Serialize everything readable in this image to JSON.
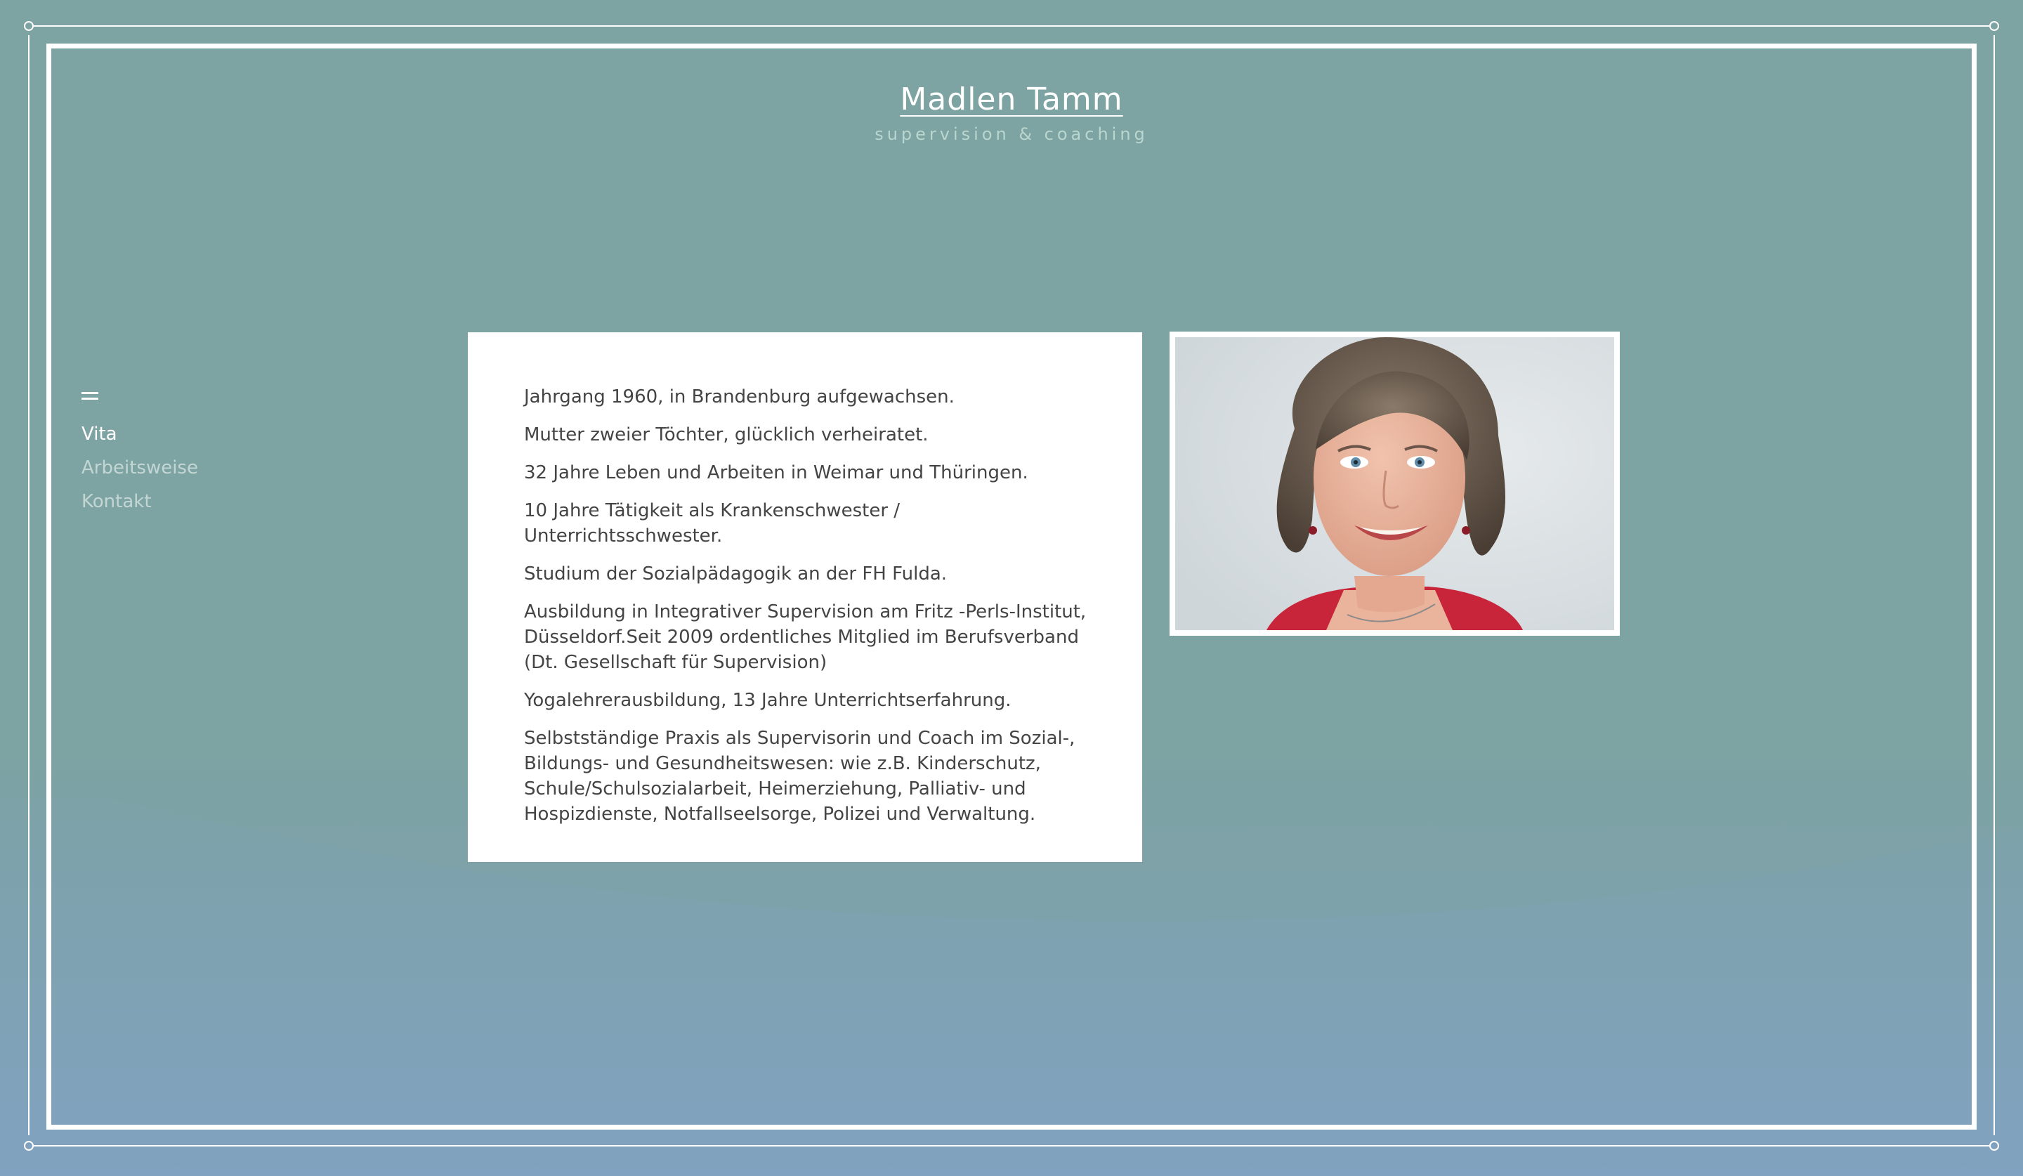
{
  "header": {
    "title": "Madlen Tamm",
    "subtitle": "supervision & coaching"
  },
  "nav": {
    "menu_icon": "hamburger-menu-icon",
    "items": [
      {
        "label": "Vita",
        "active": true
      },
      {
        "label": "Arbeitsweise",
        "active": false
      },
      {
        "label": "Kontakt",
        "active": false
      }
    ]
  },
  "vita": {
    "paragraphs": [
      "Jahrgang 1960, in Brandenburg aufgewachsen.",
      "Mutter zweier Töchter, glücklich verheiratet.",
      "32 Jahre Leben und Arbeiten in Weimar und Thüringen.",
      "10 Jahre Tätigkeit als Krankenschwester / Unterrichtsschwester.",
      "Studium der Sozialpädagogik an der FH Fulda.",
      "Ausbildung in Integrativer Supervision am Fritz -Perls-Institut, Düsseldorf.Seit 2009 ordentliches Mitglied im Berufsverband (Dt. Gesellschaft für Supervision)",
      "Yogalehrerausbildung, 13 Jahre Unterrichtserfahrung.",
      "Selbstständige Praxis als Supervisorin und Coach im Sozial-, Bildungs- und Gesundheitswesen: wie z.B. Kinderschutz, Schule/Schulsozialarbeit, Heimerziehung, Palliativ- und Hospizdienste, Notfallseelsorge, Polizei und Verwaltung."
    ]
  },
  "colors": {
    "background": "#7da3a2",
    "background_bottom": "#80a2bd",
    "frame": "#ffffff",
    "subtitle": "#b9d6cf",
    "nav_inactive": "#c2d6d4",
    "text": "#444444"
  }
}
